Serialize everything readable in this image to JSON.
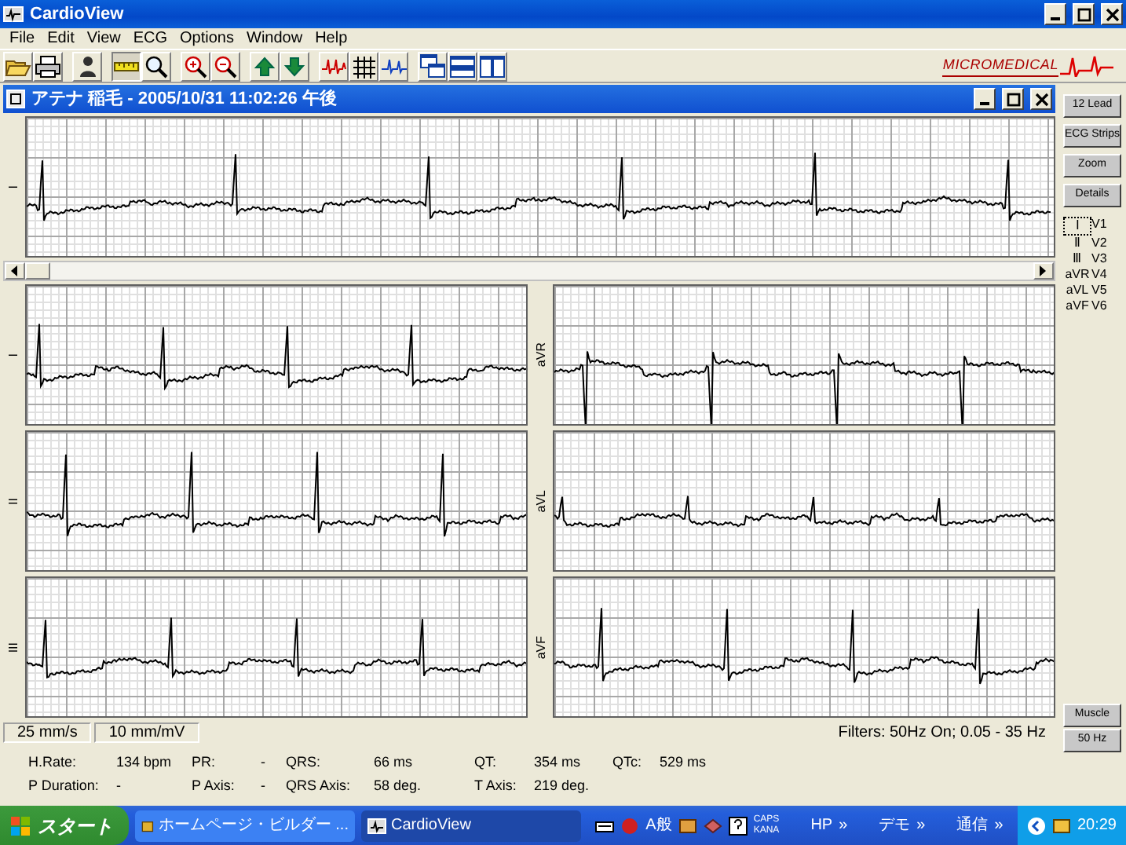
{
  "window": {
    "title": "CardioView"
  },
  "menu": [
    "File",
    "Edit",
    "View",
    "ECG",
    "Options",
    "Window",
    "Help"
  ],
  "logo": "MICROMEDICAL",
  "record": {
    "title": "アテナ 稲毛 - 2005/10/31 11:02:26 午後"
  },
  "rhythm_strip": {
    "lead": "I"
  },
  "leads": [
    {
      "lead": "I"
    },
    {
      "lead": "aVR"
    },
    {
      "lead": "II"
    },
    {
      "lead": "aVL"
    },
    {
      "lead": "III"
    },
    {
      "lead": "aVF"
    }
  ],
  "status": {
    "speed": "25 mm/s",
    "gain": "10 mm/mV",
    "filters": "Filters: 50Hz On; 0.05 - 35 Hz"
  },
  "measurements": [
    [
      {
        "label": "H.Rate:",
        "value": "134 bpm"
      },
      {
        "label": "PR:",
        "value": "-"
      },
      {
        "label": "QRS:",
        "value": "66 ms"
      },
      {
        "label": "QT:",
        "value": "354 ms"
      },
      {
        "label": "QTc:",
        "value": "529 ms"
      }
    ],
    [
      {
        "label": "P Duration:",
        "value": "-"
      },
      {
        "label": "P Axis:",
        "value": "-"
      },
      {
        "label": "QRS Axis:",
        "value": "58 deg."
      },
      {
        "label": "T Axis:",
        "value": "219 deg."
      }
    ]
  ],
  "side_buttons": [
    "12 Lead",
    "ECG Strips",
    "Zoom",
    "Details"
  ],
  "lead_list": [
    {
      "limb": "Ⅰ",
      "chest": "V1",
      "selected": true
    },
    {
      "limb": "Ⅱ",
      "chest": "V2",
      "selected": false
    },
    {
      "limb": "Ⅲ",
      "chest": "V3",
      "selected": false
    },
    {
      "limb": "aVR",
      "chest": "V4",
      "selected": false
    },
    {
      "limb": "aVL",
      "chest": "V5",
      "selected": false
    },
    {
      "limb": "aVF",
      "chest": "V6",
      "selected": false
    }
  ],
  "filter_buttons": [
    "Muscle",
    "50 Hz"
  ],
  "taskbar": {
    "start": "スタート",
    "tasks": [
      {
        "label": "ホームページ・ビルダー ...",
        "selected": false
      },
      {
        "label": "CardioView",
        "selected": true
      }
    ],
    "ime": "A般",
    "caps": "CAPS",
    "kana": "KANA",
    "toolbars": [
      {
        "label": "HP",
        "chevron": "»"
      },
      {
        "label": "デモ",
        "chevron": "»"
      },
      {
        "label": "通信",
        "chevron": "»"
      }
    ],
    "clock": "20:29"
  }
}
